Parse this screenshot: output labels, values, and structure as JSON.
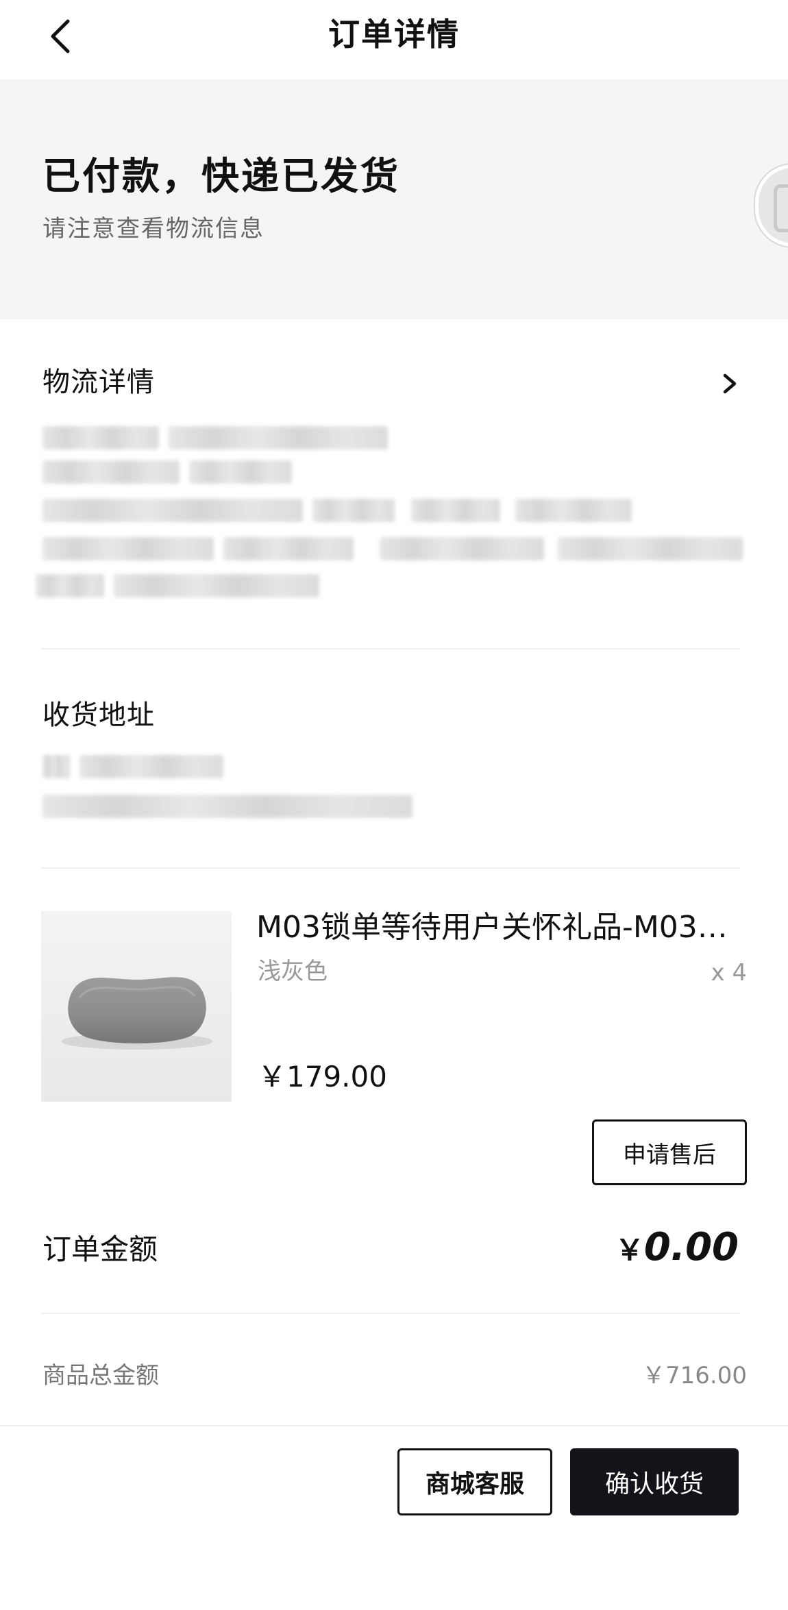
{
  "header": {
    "title": "订单详情",
    "back_icon": "chevron-left-icon"
  },
  "status": {
    "title": "已付款，快递已发货",
    "subtitle": "请注意查看物流信息",
    "illustration_icon": "delivery-truck-icon"
  },
  "logistics": {
    "title": "物流详情",
    "chevron_icon": "chevron-right-icon"
  },
  "address": {
    "title": "收货地址"
  },
  "product": {
    "name": "M03锁单等待用户关怀礼品-M03…",
    "variant": "浅灰色",
    "quantity": "x 4",
    "price": "￥179.00",
    "aftersale_label": "申请售后"
  },
  "order": {
    "amount_label": "订单金额",
    "amount_currency": "￥",
    "amount_value": "0.00",
    "goods_total_label": "商品总金额",
    "goods_total_value": "￥716.00"
  },
  "actions": {
    "service_label": "商城客服",
    "confirm_label": "确认收货"
  },
  "colors": {
    "primary_dark": "#12141a",
    "banner_bg": "#f5f5f5",
    "muted_text": "#999999"
  }
}
